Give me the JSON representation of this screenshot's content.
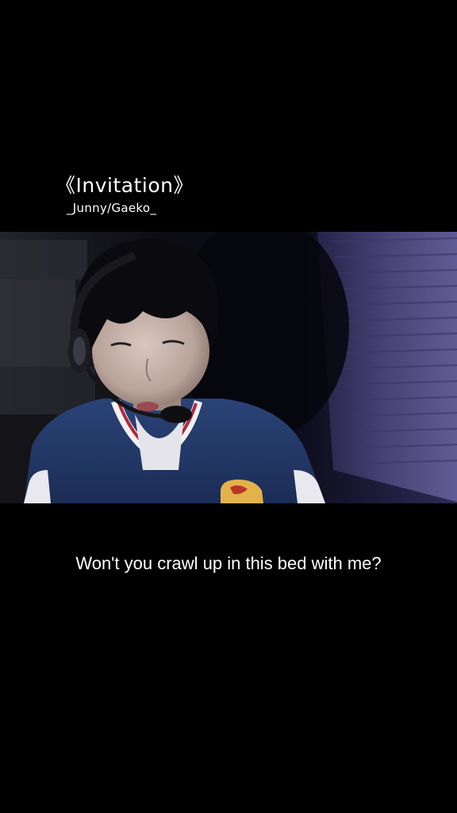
{
  "header": {
    "title": "《Invitation》",
    "artist": "_Junny/Gaeko_"
  },
  "video": {
    "scene": "person-wearing-headset-in-dim-room"
  },
  "caption": {
    "lyric": "Won't you crawl up in this bed with me?"
  },
  "colors": {
    "background": "#000000",
    "text": "#ffffff",
    "blinds": "#5a5488",
    "jacket": "#233a6b"
  }
}
